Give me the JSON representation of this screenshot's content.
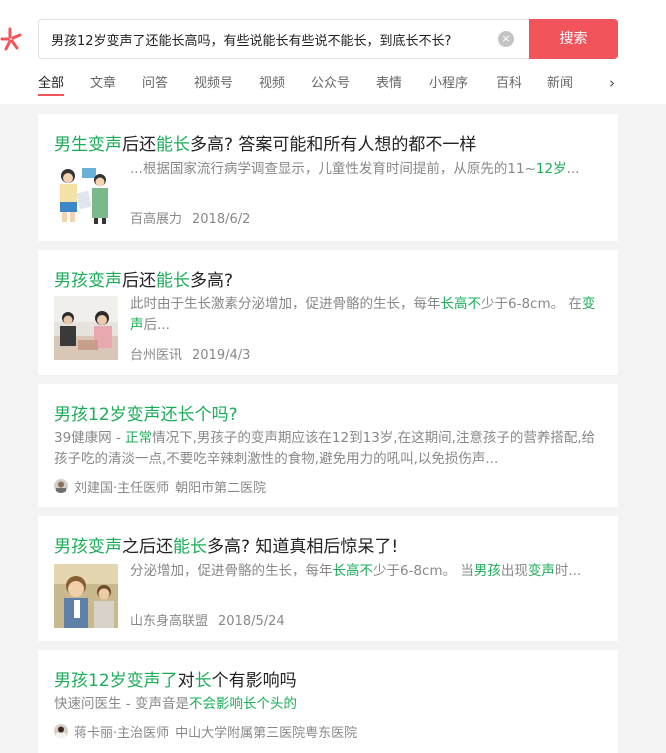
{
  "search": {
    "query": "男孩12岁变声了还能长高吗，有些说能长有些说不能长，到底长不长?",
    "button_label": "搜索"
  },
  "tabs": [
    "全部",
    "文章",
    "问答",
    "视频号",
    "视频",
    "公众号",
    "表情",
    "小程序",
    "百科",
    "新闻"
  ],
  "results": [
    {
      "title": [
        "男生变声",
        "后还",
        "能长",
        "多高? 答案可能和所有人想的都不一样"
      ],
      "snippet": [
        "...根据国家流行病学调查显示，儿童性发育时间提前，从原先的11~",
        "12岁",
        "..."
      ],
      "source": "百高展力",
      "date": "2018/6/2"
    },
    {
      "title": [
        "男孩变声",
        "后还",
        "能长",
        "多高?"
      ],
      "snippet": [
        "此时由于生长激素分泌增加，促进骨骼的生长，每年",
        "长高不",
        "少于6-8cm。 在",
        "变声",
        "后..."
      ],
      "source": "台州医讯",
      "date": "2019/4/3"
    },
    {
      "title": [
        "男孩12岁变声还长",
        "个吗?"
      ],
      "snippet": [
        "39健康网 - ",
        "正常",
        "情况下,男孩子的变声期应该在12到13岁,在这期间,注意孩子的营养搭配,给孩子吃的清淡一点,不要吃辛辣刺激性的食物,避免用力的吼叫,以免损伤声..."
      ],
      "doctor_name": "刘建国·主任医师",
      "hospital": "朝阳市第二医院"
    },
    {
      "title": [
        "男孩变声",
        "之后还",
        "能长",
        "多高? 知道真相后惊呆了!"
      ],
      "snippet": [
        "分泌增加，促进骨骼的生长，每年",
        "长高不",
        "少于6-8cm。 当",
        "男孩",
        "出现",
        "变声",
        "时..."
      ],
      "source": "山东身高联盟",
      "date": "2018/5/24"
    },
    {
      "title": [
        "男孩12岁变声了",
        "对",
        "长",
        "个有影响吗"
      ],
      "snippet": [
        "快速问医生 - 变声音是",
        "不会影响长个头的"
      ],
      "doctor_name": "蒋卡丽·主治医师",
      "hospital": "中山大学附属第三医院粤东医院"
    }
  ],
  "colors": {
    "accent_red": "#f2545b",
    "highlight_green": "#1aad57"
  }
}
